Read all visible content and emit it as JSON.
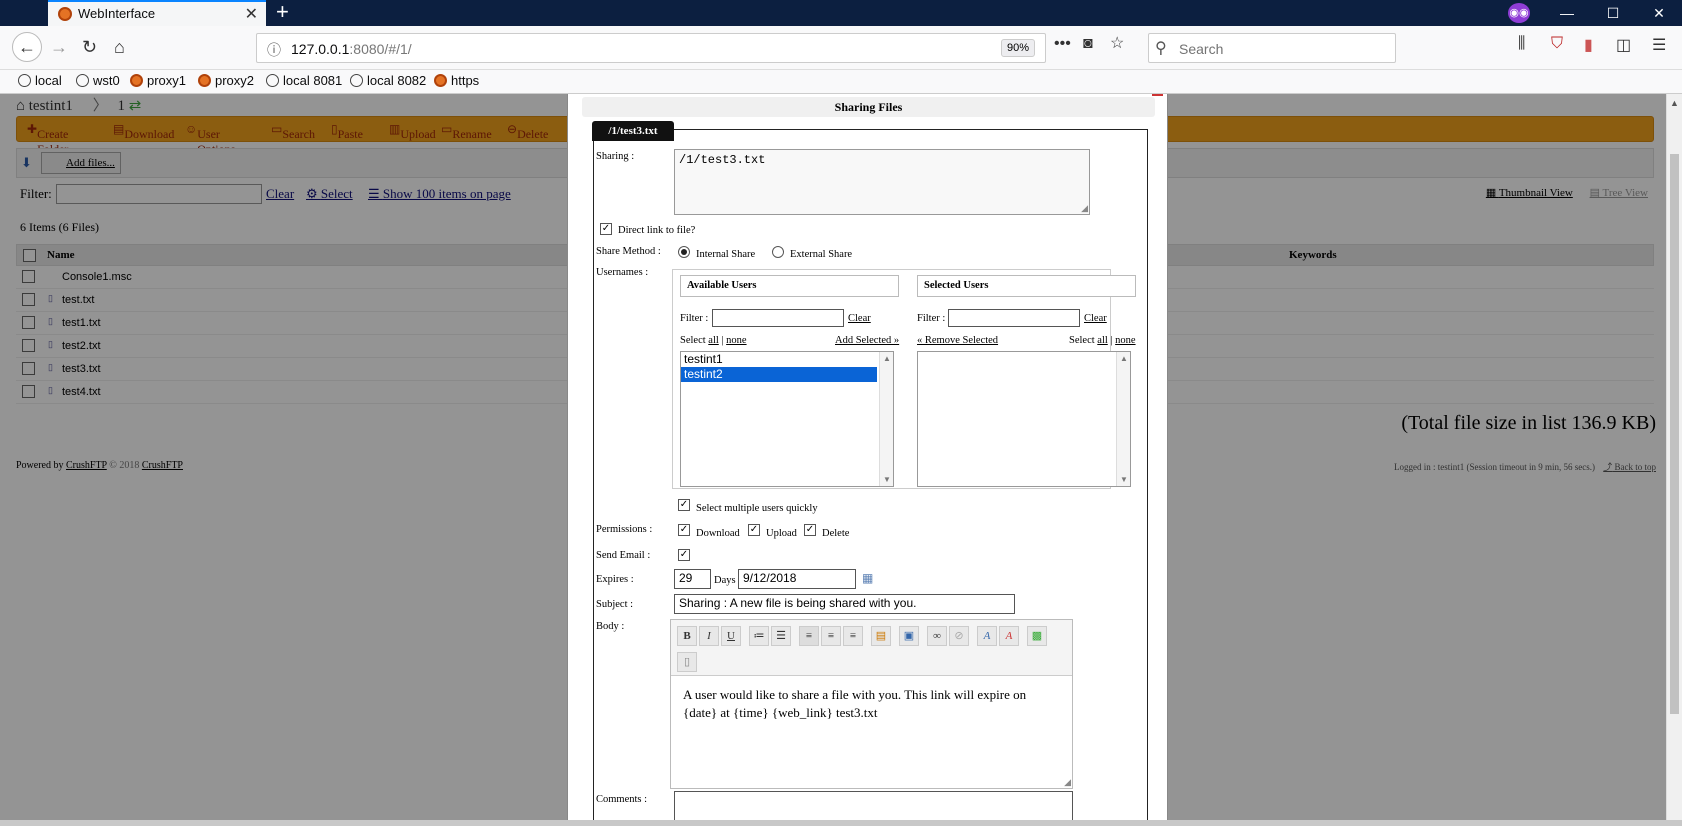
{
  "browser": {
    "tab_title": "WebInterface",
    "url_host": "127.0.0.1",
    "url_rest": ":8080/#/1/",
    "zoom": "90%",
    "search_placeholder": "Search",
    "bookmarks": [
      "local",
      "wst0",
      "proxy1",
      "proxy2",
      "local 8081",
      "local 8082",
      "https"
    ]
  },
  "page": {
    "breadcrumb_root": "testint1",
    "breadcrumb_page": "1",
    "toolbar": [
      "Create Folder",
      "Download",
      "User Options",
      "Search",
      "Paste",
      "Upload",
      "Rename",
      "Delete"
    ],
    "add_files": "Add files...",
    "filter_label": "Filter:",
    "filter_clear": "Clear",
    "filter_select": "Select",
    "show_items": "Show 100 items on page",
    "thumbnail_view": "Thumbnail View",
    "tree_view": "Tree View",
    "items_count": "6 Items (6 Files)",
    "col_name": "Name",
    "col_keywords": "Keywords",
    "files": [
      "Console1.msc",
      "test.txt",
      "test1.txt",
      "test2.txt",
      "test3.txt",
      "test4.txt"
    ],
    "total_size": "(Total file size in list 136.9 KB)",
    "powered_by": "Powered by",
    "powered_link": "CrushFTP",
    "copyright": "© 2018",
    "copyright_link": "CrushFTP",
    "logged_in": "Logged in : testint1  (Session timeout in 9 min, 56 secs.)",
    "back_to_top": "Back to top"
  },
  "modal": {
    "title": "Sharing Files",
    "path_tab": "/1/test3.txt",
    "sharing_label": "Sharing :",
    "sharing_value": "/1/test3.txt",
    "direct_link": "Direct link to file?",
    "share_method_label": "Share Method :",
    "internal_share": "Internal Share",
    "external_share": "External Share",
    "usernames_label": "Usernames :",
    "available_users": "Available Users",
    "selected_users": "Selected Users",
    "filter_label": "Filter :",
    "clear": "Clear",
    "select_label": "Select",
    "all": "all",
    "pipe": "|",
    "none": "none",
    "add_selected": "Add Selected »",
    "remove_selected": "« Remove Selected",
    "available_list": [
      "testint1",
      "testint2"
    ],
    "selected_index": 1,
    "select_multiple": "Select multiple users quickly",
    "permissions_label": "Permissions :",
    "perm_download": "Download",
    "perm_upload": "Upload",
    "perm_delete": "Delete",
    "send_email_label": "Send Email :",
    "expires_label": "Expires :",
    "expires_days": "29",
    "days_label": "Days",
    "expires_date": "9/12/2018",
    "subject_label": "Subject :",
    "subject_value": "Sharing : A new file is being shared with you.",
    "body_label": "Body :",
    "body_text": "A user would like to share a file with you. This link will expire on {date} at {time} {web_link} test3.txt",
    "comments_label": "Comments :"
  }
}
